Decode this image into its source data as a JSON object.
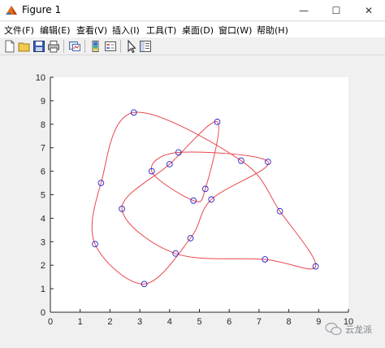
{
  "window": {
    "title": "Figure 1"
  },
  "title_buttons": {
    "minimize": "—",
    "maximize": "☐",
    "close": "✕"
  },
  "menu": [
    "文件(F)",
    "编辑(E)",
    "查看(V)",
    "插入(I)",
    "工具(T)",
    "桌面(D)",
    "窗口(W)",
    "帮助(H)"
  ],
  "toolbar_icons": [
    "new-figure-icon",
    "open-folder-icon",
    "save-icon",
    "print-icon",
    "link-plot-icon",
    "colorbar-icon",
    "legend-icon",
    "pointer-icon",
    "property-inspector-icon"
  ],
  "watermark": "云龙派",
  "colors": {
    "curve": "#e8474f",
    "markers": "#2222cc",
    "axes_bg": "#ffffff",
    "figure_bg": "#f0f0f0"
  },
  "chart_data": {
    "type": "line",
    "xlim": [
      0,
      10
    ],
    "ylim": [
      0,
      10
    ],
    "xticks": [
      0,
      1,
      2,
      3,
      4,
      5,
      6,
      7,
      8,
      9,
      10
    ],
    "yticks": [
      0,
      1,
      2,
      3,
      4,
      5,
      6,
      7,
      8,
      9,
      10
    ],
    "grid": false,
    "points": [
      [
        4.8,
        4.75
      ],
      [
        3.4,
        6.0
      ],
      [
        4.3,
        6.8
      ],
      [
        7.3,
        6.4
      ],
      [
        5.4,
        4.8
      ],
      [
        4.7,
        3.15
      ],
      [
        3.15,
        1.2
      ],
      [
        1.5,
        2.9
      ],
      [
        1.7,
        5.5
      ],
      [
        2.8,
        8.5
      ],
      [
        6.4,
        6.45
      ],
      [
        7.7,
        4.3
      ],
      [
        8.9,
        1.95
      ],
      [
        7.2,
        2.25
      ],
      [
        4.2,
        2.5
      ],
      [
        2.4,
        4.4
      ],
      [
        4.0,
        6.3
      ],
      [
        5.6,
        8.1
      ],
      [
        5.2,
        5.25
      ]
    ],
    "markers": "circle",
    "curve": "smooth interpolating closed curve through the points"
  }
}
